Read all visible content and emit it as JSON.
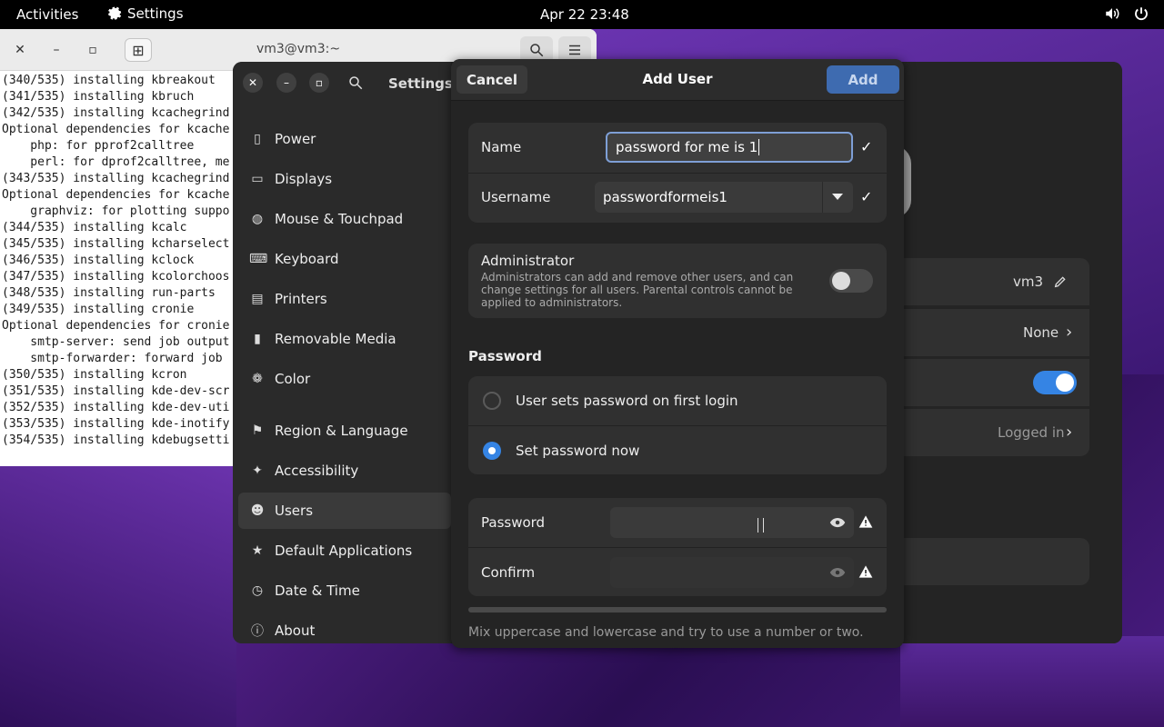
{
  "topbar": {
    "activities": "Activities",
    "app_name": "Settings",
    "clock": "Apr 22  23:48"
  },
  "terminal": {
    "title": "vm3@vm3:~",
    "lines": [
      "(340/535) installing kbreakout",
      "(341/535) installing kbruch",
      "(342/535) installing kcachegrind",
      "Optional dependencies for kcache",
      "    php: for pprof2calltree",
      "    perl: for dprof2calltree, me",
      "(343/535) installing kcachegrind",
      "Optional dependencies for kcache",
      "    graphviz: for plotting suppo",
      "(344/535) installing kcalc",
      "(345/535) installing kcharselect",
      "(346/535) installing kclock",
      "(347/535) installing kcolorchoos",
      "(348/535) installing run-parts",
      "(349/535) installing cronie",
      "Optional dependencies for cronie",
      "    smtp-server: send job output",
      "    smtp-forwarder: forward job",
      "(350/535) installing kcron",
      "(351/535) installing kde-dev-scr",
      "(352/535) installing kde-dev-uti",
      "(353/535) installing kde-inotify",
      "(354/535) installing kdebugsetti"
    ]
  },
  "settings": {
    "title": "Settings",
    "sidebar": [
      {
        "label": "Power",
        "icon": "power-icon"
      },
      {
        "label": "Displays",
        "icon": "display-icon"
      },
      {
        "label": "Mouse & Touchpad",
        "icon": "mouse-icon"
      },
      {
        "label": "Keyboard",
        "icon": "keyboard-icon"
      },
      {
        "label": "Printers",
        "icon": "printer-icon"
      },
      {
        "label": "Removable Media",
        "icon": "media-icon"
      },
      {
        "label": "Color",
        "icon": "color-icon"
      },
      {
        "label": "Region & Language",
        "icon": "flag-icon"
      },
      {
        "label": "Accessibility",
        "icon": "accessibility-icon"
      },
      {
        "label": "Users",
        "icon": "users-icon",
        "active": true
      },
      {
        "label": "Default Applications",
        "icon": "star-icon"
      },
      {
        "label": "Date & Time",
        "icon": "clock-icon"
      },
      {
        "label": "About",
        "icon": "info-icon"
      }
    ],
    "users_panel": {
      "username": "vm3",
      "parental": "None",
      "login_status": "Logged in"
    }
  },
  "dialog": {
    "title": "Add User",
    "cancel_label": "Cancel",
    "add_label": "Add",
    "name_label": "Name",
    "name_value": "password for me is 1",
    "username_label": "Username",
    "username_value": "passwordformeis1",
    "admin_title": "Administrator",
    "admin_desc": "Administrators can add and remove other users, and can change settings for all users. Parental controls cannot be applied to administrators.",
    "admin_enabled": false,
    "password_section": "Password",
    "option_first_login": "User sets password on first login",
    "option_set_now": "Set password now",
    "selected_option": "set_now",
    "password_label": "Password",
    "password_value": "",
    "confirm_label": "Confirm",
    "confirm_value": "",
    "hint": "Mix uppercase and lowercase and try to use a number or two."
  },
  "colors": {
    "accent": "#3584e4",
    "dialog_bg": "#242424",
    "card_bg": "#303030"
  }
}
